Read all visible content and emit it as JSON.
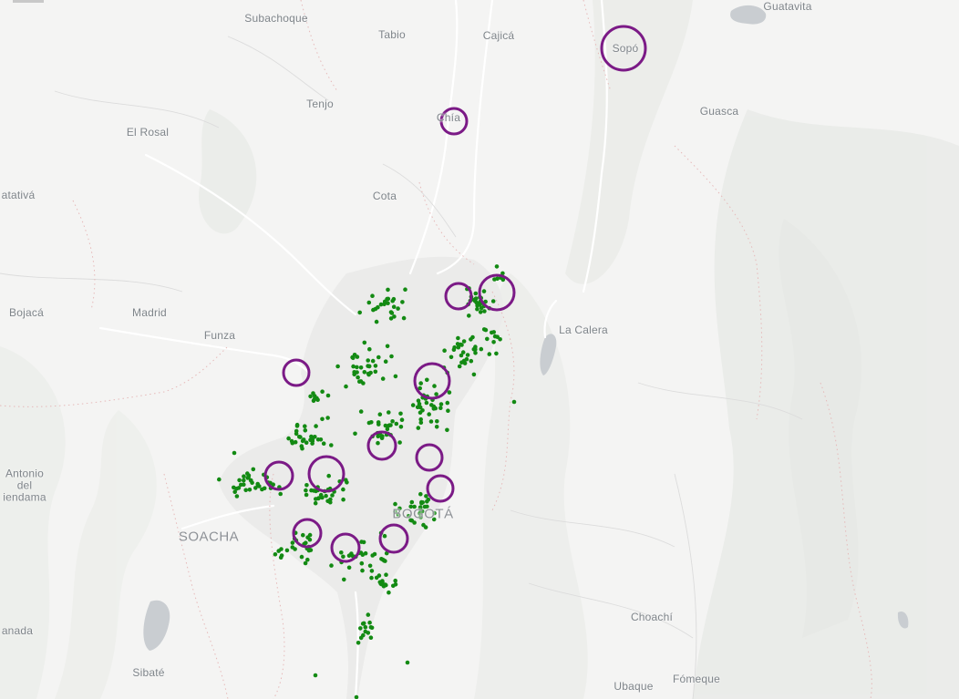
{
  "map": {
    "places": [
      {
        "name": "Subachoque",
        "size": "normal"
      },
      {
        "name": "Tabio",
        "size": "normal"
      },
      {
        "name": "Cajicá",
        "size": "normal"
      },
      {
        "name": "Guatavita",
        "size": "normal"
      },
      {
        "name": "Sopó",
        "size": "normal"
      },
      {
        "name": "Chía",
        "size": "normal"
      },
      {
        "name": "Tenjo",
        "size": "normal"
      },
      {
        "name": "Guasca",
        "size": "normal"
      },
      {
        "name": "El Rosal",
        "size": "normal"
      },
      {
        "name": "atativá",
        "size": "normal"
      },
      {
        "name": "Cota",
        "size": "normal"
      },
      {
        "name": "Bojacá",
        "size": "normal"
      },
      {
        "name": "Madrid",
        "size": "normal"
      },
      {
        "name": "Funza",
        "size": "normal"
      },
      {
        "name": "La Calera",
        "size": "normal"
      },
      {
        "name": "Antonio del iendama",
        "size": "normal"
      },
      {
        "name": "SOACHA",
        "size": "big"
      },
      {
        "name": "BOGOTÁ",
        "size": "big"
      },
      {
        "name": "Choachí",
        "size": "normal"
      },
      {
        "name": "anada",
        "size": "normal"
      },
      {
        "name": "Sibaté",
        "size": "normal"
      },
      {
        "name": "Ubaque",
        "size": "normal"
      },
      {
        "name": "Fómeque",
        "size": "normal"
      }
    ],
    "colors": {
      "background": "#f4f4f3",
      "point_color": "#138a13",
      "circle_color": "#7b1a86",
      "label_color": "#7f858a",
      "urban_color": "#ebebea",
      "water_color": "#c9cdd1"
    },
    "green_point_count": 400,
    "purple_circle_count": 15
  }
}
